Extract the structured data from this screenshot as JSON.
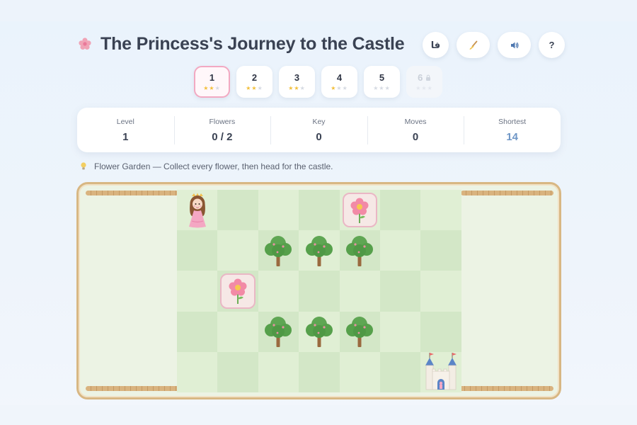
{
  "header": {
    "title": "The Princess's Journey to the Castle",
    "title_icon": "flower-icon",
    "buttons": [
      {
        "name": "language-button",
        "label": "فا",
        "icon": "language-icon"
      },
      {
        "name": "restart-button",
        "label": "",
        "icon": "broom-icon"
      },
      {
        "name": "sound-button",
        "label": "",
        "icon": "speaker-icon"
      },
      {
        "name": "help-button",
        "label": "?",
        "icon": "help-icon"
      }
    ]
  },
  "levels": [
    {
      "label": "1",
      "stars": 2,
      "active": true,
      "locked": false
    },
    {
      "label": "2",
      "stars": 2,
      "active": false,
      "locked": false
    },
    {
      "label": "3",
      "stars": 2,
      "active": false,
      "locked": false
    },
    {
      "label": "4",
      "stars": 1,
      "active": false,
      "locked": false
    },
    {
      "label": "5",
      "stars": 0,
      "active": false,
      "locked": false
    },
    {
      "label": "6",
      "stars": 0,
      "active": false,
      "locked": true
    }
  ],
  "stats": {
    "level": {
      "label": "Level",
      "value": "1"
    },
    "flowers": {
      "label": "Flowers",
      "value": "0 / 2"
    },
    "key": {
      "label": "Key",
      "value": "0"
    },
    "moves": {
      "label": "Moves",
      "value": "0"
    },
    "shortest": {
      "label": "Shortest",
      "value": "14"
    }
  },
  "hint": "Flower Garden — Collect every flower, then head for the castle.",
  "board": {
    "rows": 5,
    "cols": 7,
    "cells": [
      [
        "princess",
        "",
        "",
        "",
        "flower",
        "",
        ""
      ],
      [
        "",
        "",
        "tree",
        "tree",
        "tree",
        "",
        ""
      ],
      [
        "",
        "flower",
        "",
        "",
        "",
        "",
        ""
      ],
      [
        "",
        "",
        "tree",
        "tree",
        "tree",
        "",
        ""
      ],
      [
        "",
        "",
        "",
        "",
        "",
        "",
        "castle"
      ]
    ]
  },
  "colors": {
    "accent": "#6e96c6",
    "active_border": "#f2a9c2",
    "star": "#f2bf3a",
    "fence": "#d9b37f"
  }
}
